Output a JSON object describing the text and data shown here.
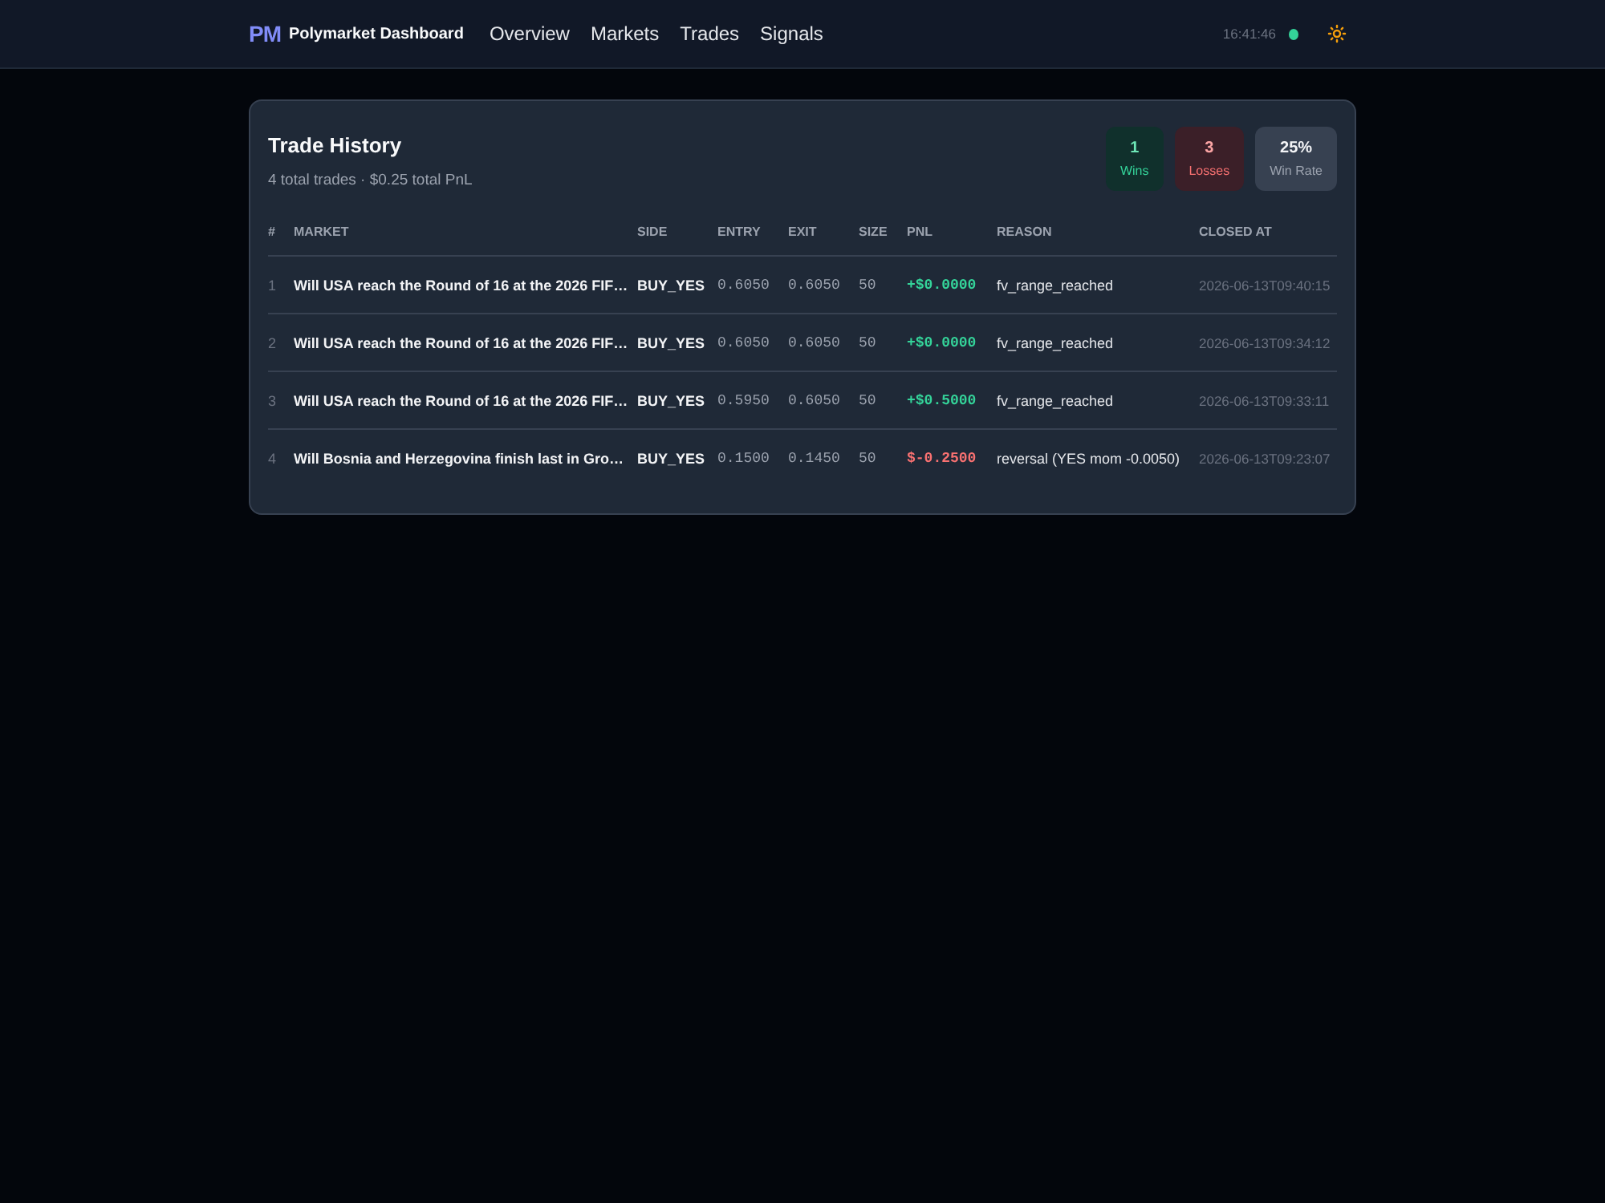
{
  "nav": {
    "logo": "PM",
    "title": "Polymarket Dashboard",
    "links": [
      {
        "label": "Overview"
      },
      {
        "label": "Markets"
      },
      {
        "label": "Trades"
      },
      {
        "label": "Signals"
      }
    ],
    "clock": "16:41:46",
    "connected": true
  },
  "card": {
    "title": "Trade History",
    "subtitle": "4 total trades · $0.25 total PnL",
    "stats": [
      {
        "kind": "wins",
        "value": "1",
        "label": "Wins"
      },
      {
        "kind": "losses",
        "value": "3",
        "label": "Losses"
      },
      {
        "kind": "rate",
        "value": "25%",
        "label": "Win Rate"
      }
    ],
    "table": {
      "columns": [
        "#",
        "MARKET",
        "SIDE",
        "ENTRY",
        "EXIT",
        "SIZE",
        "PNL",
        "REASON",
        "CLOSED AT"
      ],
      "rows": [
        {
          "index": "1",
          "market": "Will USA reach the Round of 16 at the 2026 FIF…",
          "side": "BUY_YES",
          "entry": "0.6050",
          "exit": "0.6050",
          "size": "50",
          "pnl": "+$0.0000",
          "pnl_positive": true,
          "reason": "fv_range_reached",
          "closed_at": "2026-06-13T09:40:15"
        },
        {
          "index": "2",
          "market": "Will USA reach the Round of 16 at the 2026 FIF…",
          "side": "BUY_YES",
          "entry": "0.6050",
          "exit": "0.6050",
          "size": "50",
          "pnl": "+$0.0000",
          "pnl_positive": true,
          "reason": "fv_range_reached",
          "closed_at": "2026-06-13T09:34:12"
        },
        {
          "index": "3",
          "market": "Will USA reach the Round of 16 at the 2026 FIF…",
          "side": "BUY_YES",
          "entry": "0.5950",
          "exit": "0.6050",
          "size": "50",
          "pnl": "+$0.5000",
          "pnl_positive": true,
          "reason": "fv_range_reached",
          "closed_at": "2026-06-13T09:33:11"
        },
        {
          "index": "4",
          "market": "Will Bosnia and Herzegovina finish last in Gro…",
          "side": "BUY_YES",
          "entry": "0.1500",
          "exit": "0.1450",
          "size": "50",
          "pnl": "$-0.2500",
          "pnl_positive": false,
          "reason": "reversal (YES mom -0.0050)",
          "closed_at": "2026-06-13T09:23:07"
        }
      ]
    }
  }
}
